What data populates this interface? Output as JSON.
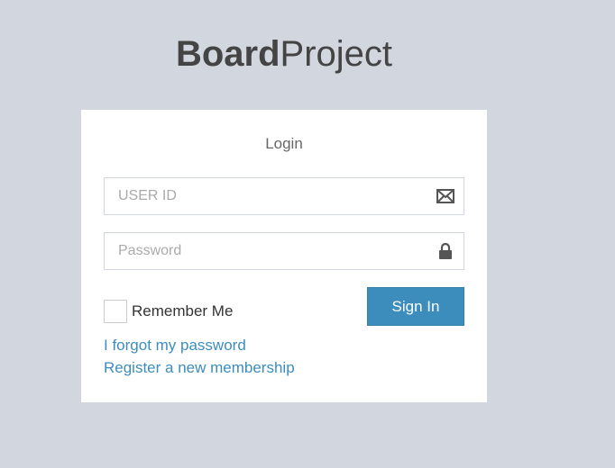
{
  "brand": {
    "bold": "Board",
    "light": "Project"
  },
  "login": {
    "message": "Login",
    "userid_placeholder": "USER ID",
    "password_placeholder": "Password",
    "remember_label": "Remember Me",
    "signin_label": "Sign In",
    "forgot_link": "I forgot my password",
    "register_link": "Register a new membership",
    "userid_icon": "envelope-icon",
    "password_icon": "lock-icon"
  },
  "colors": {
    "background": "#d2d6de",
    "primary": "#3c8dbc",
    "card": "#ffffff"
  }
}
